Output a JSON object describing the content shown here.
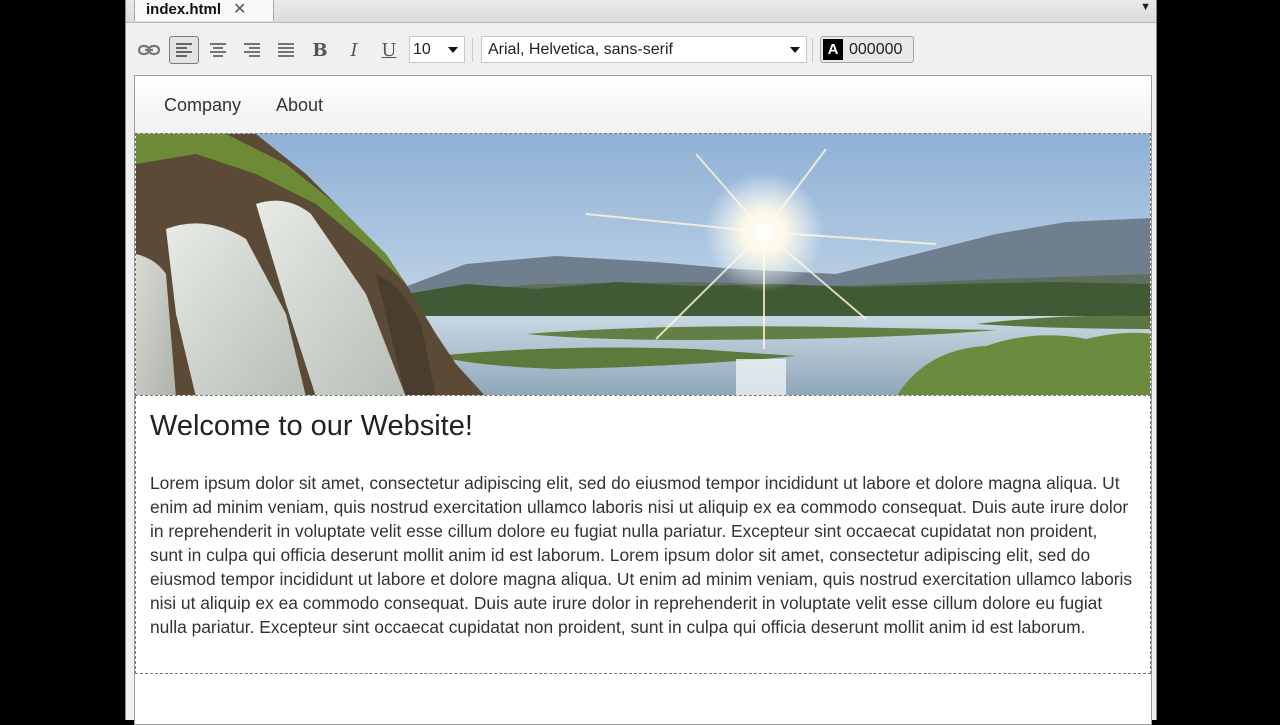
{
  "tab": {
    "title": "index.html",
    "close_glyph": "✕",
    "menu_glyph": "▼"
  },
  "toolbar": {
    "bold_label": "B",
    "italic_label": "I",
    "underline_label": "U",
    "font_size": "10",
    "font_family": "Arial, Helvetica, sans-serif",
    "color_letter": "A",
    "color_value": "000000",
    "text_color": "#000000"
  },
  "nav": {
    "items": [
      "Company",
      "About"
    ]
  },
  "hero": {
    "image_description": "waterfall-river-sunrise-landscape"
  },
  "content": {
    "heading": "Welcome to our Website!",
    "paragraph": "Lorem ipsum dolor sit amet, consectetur adipiscing elit, sed do eiusmod tempor incididunt ut labore et dolore magna aliqua. Ut enim ad minim veniam, quis nostrud exercitation ullamco laboris nisi ut aliquip ex ea commodo consequat. Duis aute irure dolor in reprehenderit in voluptate velit esse cillum dolore eu fugiat nulla pariatur. Excepteur sint occaecat cupidatat non proident, sunt in culpa qui officia deserunt mollit anim id est laborum. Lorem ipsum dolor sit amet, consectetur adipiscing elit, sed do eiusmod tempor incididunt ut labore et dolore magna aliqua. Ut enim ad minim veniam, quis nostrud exercitation ullamco laboris nisi ut aliquip ex ea commodo consequat. Duis aute irure dolor in reprehenderit in voluptate velit esse cillum dolore eu fugiat nulla pariatur. Excepteur sint occaecat cupidatat non proident, sunt in culpa qui officia deserunt mollit anim id est laborum."
  }
}
